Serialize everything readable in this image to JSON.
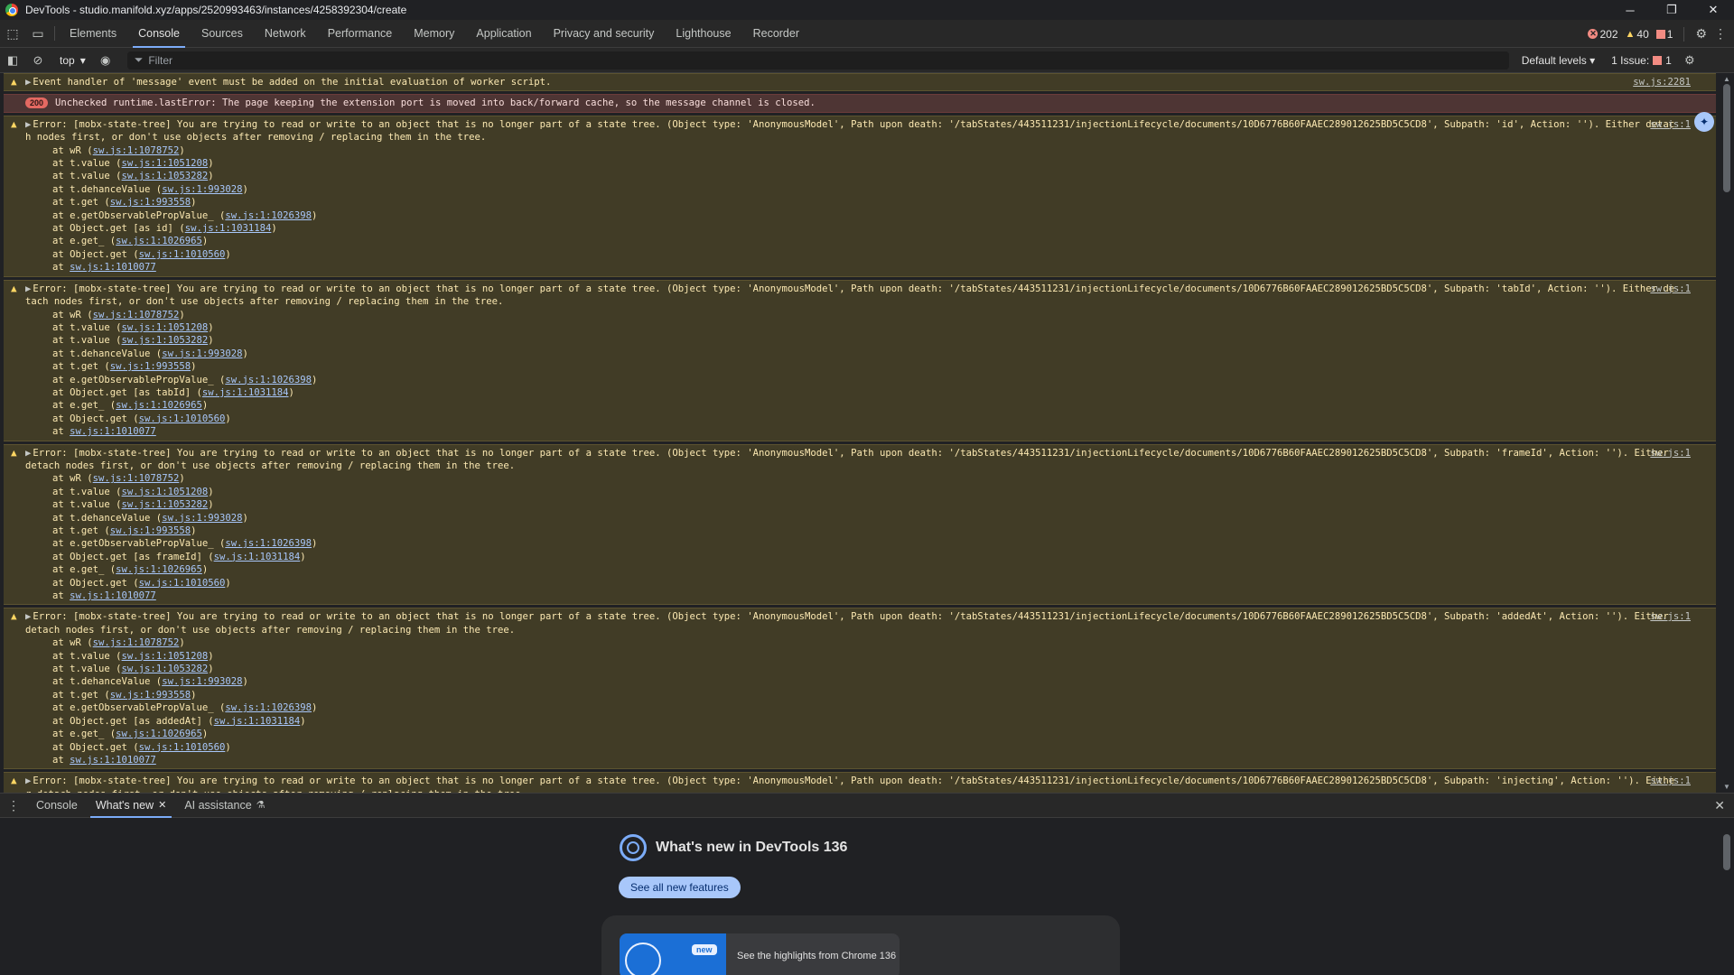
{
  "window": {
    "title": "DevTools - studio.manifold.xyz/apps/2520993463/instances/4258392304/create",
    "minimize": "─",
    "restore": "❐",
    "close": "✕"
  },
  "tabs": [
    "Elements",
    "Console",
    "Sources",
    "Network",
    "Performance",
    "Memory",
    "Application",
    "Privacy and security",
    "Lighthouse",
    "Recorder"
  ],
  "active_tab": "Console",
  "counts": {
    "errors": "202",
    "warnings": "40",
    "issues": "1"
  },
  "toolbar": {
    "context": "top",
    "filter_placeholder": "Filter",
    "levels": "Default levels",
    "issues_label": "1 Issue:",
    "issues_count": "1"
  },
  "messages": [
    {
      "level": "warn",
      "text": "Event handler of 'message' event must be added on the initial evaluation of worker script.",
      "source": "sw.js:2281",
      "stack": []
    },
    {
      "level": "error",
      "badge": "200",
      "text": "Unchecked runtime.lastError: The page keeping the extension port is moved into back/forward cache, so the message channel is closed.",
      "source": "",
      "stack": []
    },
    {
      "level": "warn",
      "text": "Error: [mobx-state-tree] You are trying to read or write to an object that is no longer part of a state tree. (Object type: 'AnonymousModel', Path upon death: '/tabStates/443511231/injectionLifecycle/documents/10D6776B60FAAEC289012625BD5C5CD8', Subpath: 'id', Action: ''). Either detach nodes first, or don't use objects after removing / replacing them in the tree.",
      "source": "sw.js:1",
      "stack": [
        [
          "at wR (",
          "sw.js:1:1078752",
          ")"
        ],
        [
          "at t.value (",
          "sw.js:1:1051208",
          ")"
        ],
        [
          "at t.value (",
          "sw.js:1:1053282",
          ")"
        ],
        [
          "at t.dehanceValue (",
          "sw.js:1:993028",
          ")"
        ],
        [
          "at t.get (",
          "sw.js:1:993558",
          ")"
        ],
        [
          "at e.getObservablePropValue_ (",
          "sw.js:1:1026398",
          ")"
        ],
        [
          "at Object.get [as id] (",
          "sw.js:1:1031184",
          ")"
        ],
        [
          "at e.get_ (",
          "sw.js:1:1026965",
          ")"
        ],
        [
          "at Object.get (",
          "sw.js:1:1010560",
          ")"
        ],
        [
          "at ",
          "sw.js:1:1010077",
          ""
        ]
      ]
    },
    {
      "level": "warn",
      "text": "Error: [mobx-state-tree] You are trying to read or write to an object that is no longer part of a state tree. (Object type: 'AnonymousModel', Path upon death: '/tabStates/443511231/injectionLifecycle/documents/10D6776B60FAAEC289012625BD5C5CD8', Subpath: 'tabId', Action: ''). Either detach nodes first, or don't use objects after removing / replacing them in the tree.",
      "source": "sw.js:1",
      "stack": [
        [
          "at wR (",
          "sw.js:1:1078752",
          ")"
        ],
        [
          "at t.value (",
          "sw.js:1:1051208",
          ")"
        ],
        [
          "at t.value (",
          "sw.js:1:1053282",
          ")"
        ],
        [
          "at t.dehanceValue (",
          "sw.js:1:993028",
          ")"
        ],
        [
          "at t.get (",
          "sw.js:1:993558",
          ")"
        ],
        [
          "at e.getObservablePropValue_ (",
          "sw.js:1:1026398",
          ")"
        ],
        [
          "at Object.get [as tabId] (",
          "sw.js:1:1031184",
          ")"
        ],
        [
          "at e.get_ (",
          "sw.js:1:1026965",
          ")"
        ],
        [
          "at Object.get (",
          "sw.js:1:1010560",
          ")"
        ],
        [
          "at ",
          "sw.js:1:1010077",
          ""
        ]
      ]
    },
    {
      "level": "warn",
      "text": "Error: [mobx-state-tree] You are trying to read or write to an object that is no longer part of a state tree. (Object type: 'AnonymousModel', Path upon death: '/tabStates/443511231/injectionLifecycle/documents/10D6776B60FAAEC289012625BD5C5CD8', Subpath: 'frameId', Action: ''). Either detach nodes first, or don't use objects after removing / replacing them in the tree.",
      "source": "sw.js:1",
      "stack": [
        [
          "at wR (",
          "sw.js:1:1078752",
          ")"
        ],
        [
          "at t.value (",
          "sw.js:1:1051208",
          ")"
        ],
        [
          "at t.value (",
          "sw.js:1:1053282",
          ")"
        ],
        [
          "at t.dehanceValue (",
          "sw.js:1:993028",
          ")"
        ],
        [
          "at t.get (",
          "sw.js:1:993558",
          ")"
        ],
        [
          "at e.getObservablePropValue_ (",
          "sw.js:1:1026398",
          ")"
        ],
        [
          "at Object.get [as frameId] (",
          "sw.js:1:1031184",
          ")"
        ],
        [
          "at e.get_ (",
          "sw.js:1:1026965",
          ")"
        ],
        [
          "at Object.get (",
          "sw.js:1:1010560",
          ")"
        ],
        [
          "at ",
          "sw.js:1:1010077",
          ""
        ]
      ]
    },
    {
      "level": "warn",
      "text": "Error: [mobx-state-tree] You are trying to read or write to an object that is no longer part of a state tree. (Object type: 'AnonymousModel', Path upon death: '/tabStates/443511231/injectionLifecycle/documents/10D6776B60FAAEC289012625BD5C5CD8', Subpath: 'addedAt', Action: ''). Either detach nodes first, or don't use objects after removing / replacing them in the tree.",
      "source": "sw.js:1",
      "stack": [
        [
          "at wR (",
          "sw.js:1:1078752",
          ")"
        ],
        [
          "at t.value (",
          "sw.js:1:1051208",
          ")"
        ],
        [
          "at t.value (",
          "sw.js:1:1053282",
          ")"
        ],
        [
          "at t.dehanceValue (",
          "sw.js:1:993028",
          ")"
        ],
        [
          "at t.get (",
          "sw.js:1:993558",
          ")"
        ],
        [
          "at e.getObservablePropValue_ (",
          "sw.js:1:1026398",
          ")"
        ],
        [
          "at Object.get [as addedAt] (",
          "sw.js:1:1031184",
          ")"
        ],
        [
          "at e.get_ (",
          "sw.js:1:1026965",
          ")"
        ],
        [
          "at Object.get (",
          "sw.js:1:1010560",
          ")"
        ],
        [
          "at ",
          "sw.js:1:1010077",
          ""
        ]
      ]
    },
    {
      "level": "warn",
      "text": "Error: [mobx-state-tree] You are trying to read or write to an object that is no longer part of a state tree. (Object type: 'AnonymousModel', Path upon death: '/tabStates/443511231/injectionLifecycle/documents/10D6776B60FAAEC289012625BD5C5CD8', Subpath: 'injecting', Action: ''). Either detach nodes first, or don't use objects after removing / replacing them in the tree.",
      "source": "sw.js:1",
      "stack": []
    }
  ],
  "drawer": {
    "tabs": [
      {
        "label": "Console",
        "active": false
      },
      {
        "label": "What's new",
        "active": true
      },
      {
        "label": "AI assistance",
        "active": false
      }
    ],
    "heading": "What's new in DevTools 136",
    "see_all": "See all new features",
    "video_badge": "new",
    "video_label": "See the highlights from Chrome 136"
  }
}
